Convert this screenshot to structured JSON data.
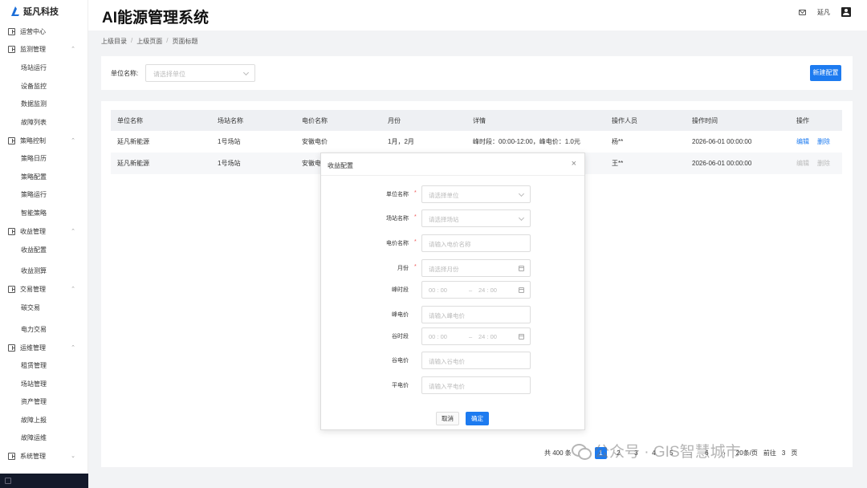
{
  "brand": {
    "name": "延凡科技"
  },
  "header": {
    "title": "AI能源管理系统",
    "user": "延凡"
  },
  "sidebar": [
    {
      "label": "运营中心",
      "kind": "group"
    },
    {
      "label": "监测管理",
      "kind": "group",
      "chev": "⌃"
    },
    {
      "label": "场站运行",
      "kind": "child"
    },
    {
      "label": "设备监控",
      "kind": "child"
    },
    {
      "label": "数据监测",
      "kind": "child"
    },
    {
      "label": "故障列表",
      "kind": "child"
    },
    {
      "label": "策略控制",
      "kind": "group",
      "chev": "⌃"
    },
    {
      "label": "策略日历",
      "kind": "child"
    },
    {
      "label": "策略配置",
      "kind": "child"
    },
    {
      "label": "策略运行",
      "kind": "child"
    },
    {
      "label": "智能策略",
      "kind": "child"
    },
    {
      "label": "收益管理",
      "kind": "group",
      "chev": "⌃"
    },
    {
      "label": "收益配置",
      "kind": "child"
    },
    {
      "label": "收益测算",
      "kind": "child"
    },
    {
      "label": "交易管理",
      "kind": "group",
      "chev": "⌃"
    },
    {
      "label": "碳交易",
      "kind": "child"
    },
    {
      "label": "电力交易",
      "kind": "child"
    },
    {
      "label": "运维管理",
      "kind": "group",
      "chev": "⌃"
    },
    {
      "label": "租赁管理",
      "kind": "child"
    },
    {
      "label": "场站管理",
      "kind": "child"
    },
    {
      "label": "资产管理",
      "kind": "child"
    },
    {
      "label": "故障上报",
      "kind": "child"
    },
    {
      "label": "故障运维",
      "kind": "child"
    },
    {
      "label": "系统管理",
      "kind": "group",
      "chev": "⌄"
    }
  ],
  "breadcrumb": [
    "上级目录",
    "上级页面",
    "页面标题"
  ],
  "filter": {
    "label": "单位名称:",
    "placeholder": "请选择单位",
    "new_button": "新建配置"
  },
  "table": {
    "columns": [
      "单位名称",
      "场站名称",
      "电价名称",
      "月份",
      "详情",
      "操作人员",
      "操作时间",
      "操作"
    ],
    "rows": [
      {
        "unit": "延凡新能源",
        "station": "1号场站",
        "price": "安徽电价",
        "month": "1月，2月",
        "detail": "峰时段：00:00-12:00，峰电价：1.0元",
        "operator": "杨**",
        "time": "2026-06-01 00:00:00",
        "edit": "编辑",
        "del": "删除"
      },
      {
        "unit": "延凡新能源",
        "station": "1号场站",
        "price": "安徽电",
        "month": "",
        "detail": "",
        "operator": "王**",
        "time": "2026-06-01 00:00:00",
        "edit": "编辑",
        "del": "删除"
      }
    ]
  },
  "pager": {
    "total": "共 400 条",
    "pages": [
      "1",
      "2",
      "3",
      "4",
      "5",
      "6"
    ],
    "ellipsis": "...",
    "per_page": "20条/页",
    "goto": "前往",
    "page_val": "3",
    "page_unit": "页"
  },
  "watermark": "公众号 · GIS智慧城市",
  "modal": {
    "title": "收益配置",
    "close": "×",
    "fields": [
      {
        "label": "单位名称",
        "req": "*",
        "placeholder": "请选择单位",
        "type": "select"
      },
      {
        "label": "场站名称",
        "req": "*",
        "placeholder": "请选择场站",
        "type": "select"
      },
      {
        "label": "电价名称",
        "req": "*",
        "placeholder": "请输入电价名称",
        "type": "input"
      },
      {
        "label": "月份",
        "req": "*",
        "placeholder": "请选择月份",
        "type": "date"
      },
      {
        "label": "峰时段",
        "req": "",
        "start": "00 : 00",
        "end": "24 : 00",
        "sep": "–",
        "type": "range"
      },
      {
        "label": "峰电价",
        "req": "",
        "placeholder": "请输入峰电价",
        "type": "input"
      },
      {
        "label": "谷时段",
        "req": "",
        "start": "00 : 00",
        "end": "24 : 00",
        "sep": "–",
        "type": "range"
      },
      {
        "label": "谷电价",
        "req": "",
        "placeholder": "请输入谷电价",
        "type": "input"
      },
      {
        "label": "平电价",
        "req": "",
        "placeholder": "请输入平电价",
        "type": "input"
      }
    ],
    "cancel": "取消",
    "ok": "确定"
  }
}
